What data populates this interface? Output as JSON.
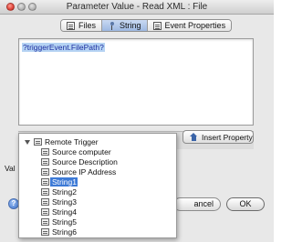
{
  "window": {
    "title": "Parameter Value - Read XML : File"
  },
  "tabs": [
    {
      "label": "Files",
      "icon": "list-icon"
    },
    {
      "label": "String",
      "icon": "pin-icon",
      "active": true
    },
    {
      "label": "Event Properties",
      "icon": "list-icon"
    }
  ],
  "editor": {
    "text": "?triggerEvent.FilePath?"
  },
  "insert_button": {
    "label": "Insert Property",
    "icon": "house-icon"
  },
  "value_label": "Val",
  "buttons": {
    "cancel": "ancel",
    "ok": "OK",
    "help": "?"
  },
  "popup": {
    "root": {
      "label": "Remote Trigger",
      "icon": "list-icon"
    },
    "items": [
      {
        "label": "Source computer"
      },
      {
        "label": "Source Description"
      },
      {
        "label": "Source IP Address"
      },
      {
        "label": "String1",
        "selected": true
      },
      {
        "label": "String2"
      },
      {
        "label": "String3"
      },
      {
        "label": "String4"
      },
      {
        "label": "String5"
      },
      {
        "label": "String6"
      }
    ]
  }
}
